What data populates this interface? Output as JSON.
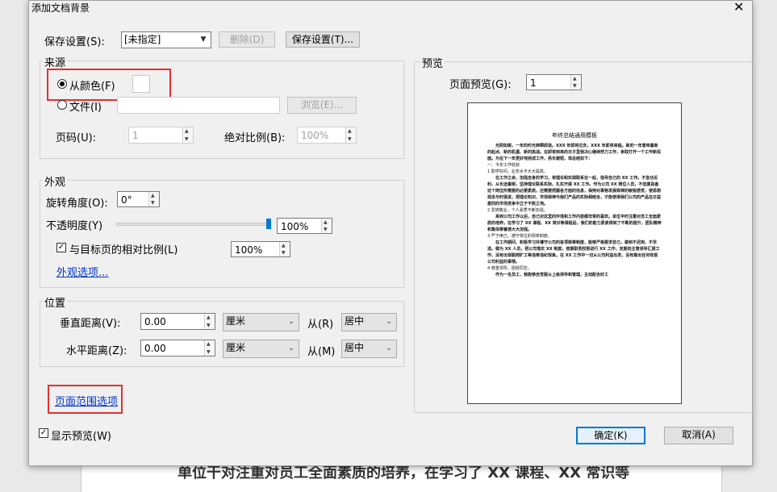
{
  "window": {
    "title": "添加文档背景",
    "close_glyph": "✕"
  },
  "background_doc": {
    "text": "单位干对注重对员工全面素质的培养，在学习了 XX 课程、XX 常识等"
  },
  "save_settings": {
    "label": "保存设置(S):",
    "value": "[未指定]",
    "delete_label": "删除(D)",
    "save_button_label": "保存设置(T)..."
  },
  "source": {
    "group_label": "来源",
    "from_color_label": "从颜色(F)",
    "from_color_selected": true,
    "swatch_color": "#ffffff",
    "file_label": "文件(I)",
    "file_path": "",
    "browse_label": "浏览(E)...",
    "page_label": "页码(U):",
    "page_value": "1",
    "abs_scale_label": "绝对比例(B):",
    "abs_scale_value": "100%"
  },
  "appearance": {
    "group_label": "外观",
    "rotation_label": "旋转角度(O):",
    "rotation_value": "0°",
    "opacity_label": "不透明度(Y)",
    "opacity_value": "100%",
    "opacity_level": 1.0,
    "relative_scale_label": "与目标页的相对比例(L)",
    "relative_scale_checked": true,
    "relative_scale_value": "100%",
    "options_link": "外观选项..."
  },
  "position": {
    "group_label": "位置",
    "vertical_label": "垂直距离(V):",
    "vertical_value": "0.00",
    "vertical_unit": "厘米",
    "vertical_from_label": "从(R)",
    "vertical_from_value": "居中",
    "horizontal_label": "水平距离(Z):",
    "horizontal_value": "0.00",
    "horizontal_unit": "厘米",
    "horizontal_from_label": "从(M)",
    "horizontal_from_value": "居中"
  },
  "page_range_link": "页面范围选项",
  "show_preview": {
    "label": "显示预览(W)",
    "checked": true
  },
  "preview": {
    "group_label": "预览",
    "page_preview_label": "页面预览(G):",
    "page_preview_value": "1",
    "doc_title": "年终总结通用模板",
    "doc_lines": [
      "光阴如梭，一年的时光转瞬即逝。XXX 年即将过去，XXX 年即将来临。新的一年意味着新的起点、新的机遇、新的挑战。在即将到来的日子里我决心继续努力工作，争取打开一个工作新局面。为在下一年更好地完成工作，扬长避短，现总结如下：",
      "一、今年工作收获",
      "1  勤学好问，业务水平大大提高。",
      "在工作之余，加强自身的学习，将理论和实践联系在一起，指导自己的 XX 工作。不急功近利，从长远着眼，坚持理论联系实际，扎实开展 XX 工作。作为公司 XX 岗位人员，不但要具备这个岗位所需要的必要素质，还需要把握各方面的信息，保持对事物发展规律的敏锐感觉，使思想观念与时俱进，把理论知识、市场规律与我们产品的实际相结合，才能使得我们公司的产品在日益激烈的市场竞争中立于不败之地。",
      "2  爱岗敬业，个人素质不断加强。",
      "来到公司工作以后，自己对这里的环境和工作内容都非常的喜欢。单位平时注重对员工全面素质的培养，在学习了 XX 课程、XX 常识等课程后，我们的能力素质得到了不断的提升，团队精神和集体荣誉感大大加强。",
      "3  严于律己，遵守单位的规章制度。",
      "在工作期间，积极学习并遵守公司的各项规章制度，能够严格要求自己，做到不迟到、不早退。做为 XX 人员，把公司落实 XX 制度，按期职责权限进行 XX 工作，定期向主管领导汇报工作，没有出现脱岗旷工等违章违纪现象。在 XX 工作中一切从公司利益出发，没有做出任何有损公司利益的事情。",
      "4  尊重领导，团结同志。",
      "作为一名员工，我能够自觉服从上级领导和管理，主动配合好工"
    ]
  },
  "buttons": {
    "ok": "确定(K)",
    "cancel": "取消(A)"
  },
  "highlights": {
    "color": "#e03030"
  }
}
